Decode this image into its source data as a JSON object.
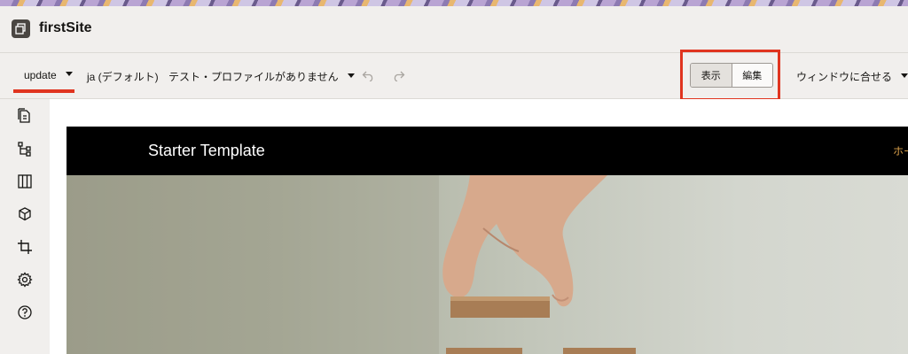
{
  "app": {
    "title": "firstSite"
  },
  "toolbar": {
    "update_label": "update",
    "language_label": "ja (デフォルト)",
    "test_profile_label": "テスト・プロファイルがありません",
    "view_label": "表示",
    "edit_label": "編集",
    "fit_label": "ウィンドウに合せる"
  },
  "sidebar": {
    "icons": [
      "pages-icon",
      "site-map-icon",
      "layout-columns-icon",
      "components-cube-icon",
      "crop-icon",
      "settings-gear-icon",
      "help-icon"
    ]
  },
  "site": {
    "title": "Starter Template",
    "nav_item": "ホーム"
  },
  "colors": {
    "highlight": "#e0341f",
    "header_bg": "#000000",
    "nav_accent": "#d9a04a"
  }
}
